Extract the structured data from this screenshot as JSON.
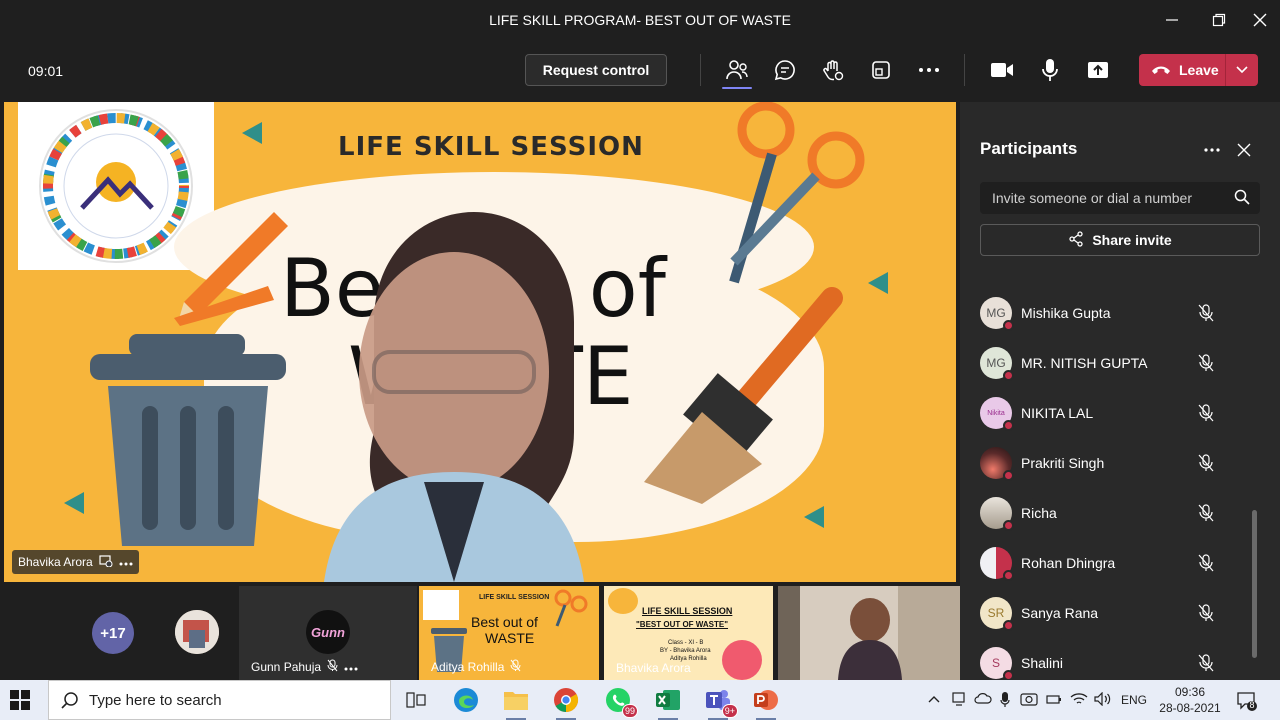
{
  "window": {
    "title": "LIFE SKILL PROGRAM- BEST OUT OF WASTE"
  },
  "toolbar": {
    "timer": "09:01",
    "request_control_label": "Request control",
    "leave_label": "Leave",
    "icons": [
      "people-icon",
      "chat-icon",
      "raise-hand-icon",
      "rooms-icon",
      "more-icon",
      "camera-icon",
      "mic-icon",
      "share-tray-icon"
    ]
  },
  "stage": {
    "heading": "LIFE SKILL SESSION",
    "big_text_line1": "Be",
    "big_text_line1b": "t of",
    "big_text_line2a": "W",
    "big_text_line2b": "TE",
    "presenter_name": "Bhavika Arora"
  },
  "strip": {
    "overflow_count": "+17",
    "tiles": [
      {
        "name": "Gunn Pahuja",
        "avatar_text": "Gunn"
      },
      {
        "name": "Aditya Rohilla",
        "slide_heading": "LIFE SKILL SESSION",
        "slide_text1": "Best out of",
        "slide_text2": "WASTE"
      },
      {
        "name": "Bhavika Arora",
        "slide_heading": "LIFE SKILL SESSION",
        "slide_text1": "\"BEST OUT OF WASTE\"",
        "slide_line1": "Class - XI - B",
        "slide_line2": "BY - Bhavika Arora",
        "slide_line3": "Aditya Rohilla"
      },
      {
        "name": ""
      }
    ]
  },
  "panel": {
    "title": "Participants",
    "invite_placeholder": "Invite someone or dial a number",
    "share_invite_label": "Share invite",
    "participants": [
      {
        "name": "Mishika Gupta",
        "initials": "MG",
        "avatar_color": "#e8e0d8"
      },
      {
        "name": "MR. NITISH GUPTA",
        "initials": "MG",
        "avatar_color": "#dfe6d8"
      },
      {
        "name": "NIKITA LAL",
        "initials": "Nikita",
        "avatar_color": "#e9c9e8"
      },
      {
        "name": "Prakriti Singh",
        "initials": "",
        "avatar_color": "#3a2a2a"
      },
      {
        "name": "Richa",
        "initials": "",
        "avatar_color": "#c9c2b8"
      },
      {
        "name": "Rohan Dhingra",
        "initials": "",
        "avatar_color": "#d8d8e0"
      },
      {
        "name": "Sanya Rana",
        "initials": "SR",
        "avatar_color": "#f1e6c8"
      },
      {
        "name": "Shalini",
        "initials": "S",
        "avatar_color": "#f4dce4"
      }
    ]
  },
  "taskbar": {
    "search_placeholder": "Type here to search",
    "whatsapp_badge": "99",
    "teams_badge": "9+",
    "language": "ENG",
    "time": "09:36",
    "date": "28-08-2021",
    "notifications": "8"
  },
  "colors": {
    "accent": "#6264a7",
    "leave": "#c4314b",
    "stage_bg": "#f7b53b"
  }
}
